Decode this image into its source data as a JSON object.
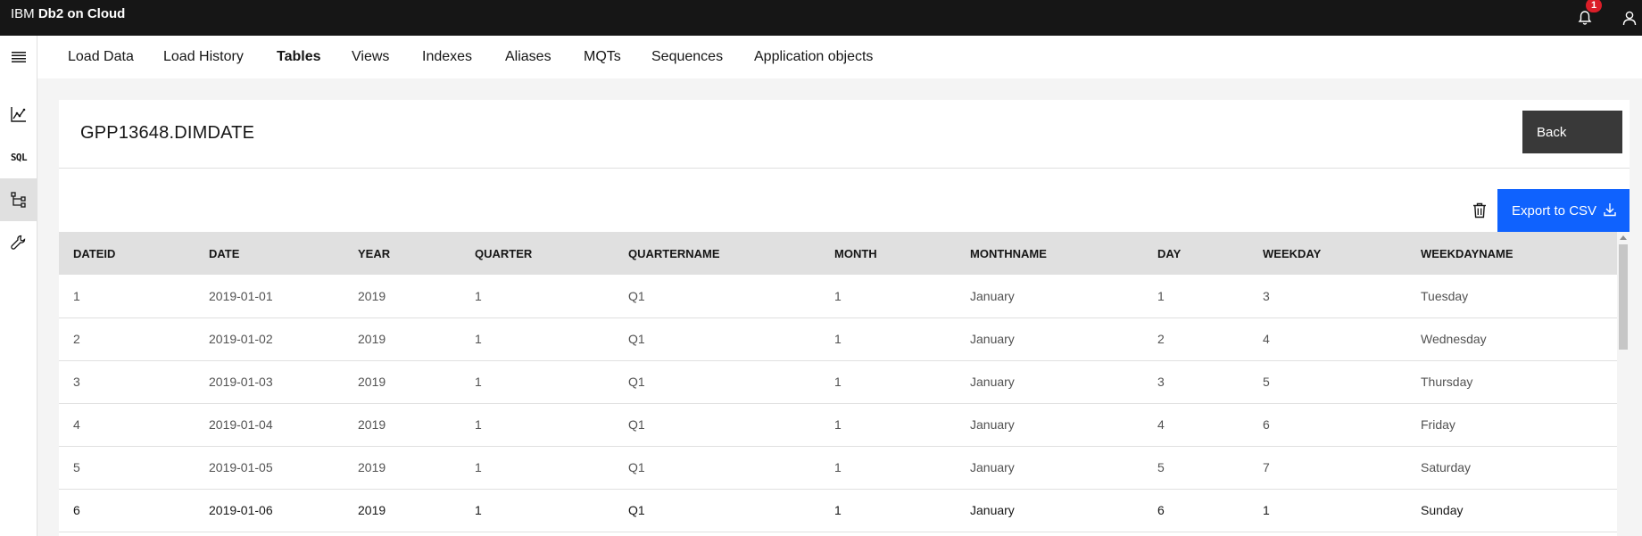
{
  "header": {
    "brand_prefix": "IBM",
    "brand_name": "Db2 on Cloud",
    "notification_count": "1"
  },
  "nav": {
    "tabs": [
      {
        "label": "Load Data",
        "active": false
      },
      {
        "label": "Load History",
        "active": false
      },
      {
        "label": "Tables",
        "active": true
      },
      {
        "label": "Views",
        "active": false
      },
      {
        "label": "Indexes",
        "active": false
      },
      {
        "label": "Aliases",
        "active": false
      },
      {
        "label": "MQTs",
        "active": false
      },
      {
        "label": "Sequences",
        "active": false
      },
      {
        "label": "Application objects",
        "active": false
      }
    ]
  },
  "rail": {
    "sql_label": "SQL"
  },
  "card": {
    "title": "GPP13648.DIMDATE",
    "back_label": "Back",
    "export_label": "Export to CSV"
  },
  "table": {
    "columns": [
      "DATEID",
      "DATE",
      "YEAR",
      "QUARTER",
      "QUARTERNAME",
      "MONTH",
      "MONTHNAME",
      "DAY",
      "WEEKDAY",
      "WEEKDAYNAME"
    ],
    "rows": [
      [
        "1",
        "2019-01-01",
        "2019",
        "1",
        "Q1",
        "1",
        "January",
        "1",
        "3",
        "Tuesday"
      ],
      [
        "2",
        "2019-01-02",
        "2019",
        "1",
        "Q1",
        "1",
        "January",
        "2",
        "4",
        "Wednesday"
      ],
      [
        "3",
        "2019-01-03",
        "2019",
        "1",
        "Q1",
        "1",
        "January",
        "3",
        "5",
        "Thursday"
      ],
      [
        "4",
        "2019-01-04",
        "2019",
        "1",
        "Q1",
        "1",
        "January",
        "4",
        "6",
        "Friday"
      ],
      [
        "5",
        "2019-01-05",
        "2019",
        "1",
        "Q1",
        "1",
        "January",
        "5",
        "7",
        "Saturday"
      ],
      [
        "6",
        "2019-01-06",
        "2019",
        "1",
        "Q1",
        "1",
        "January",
        "6",
        "1",
        "Sunday"
      ]
    ]
  },
  "colors": {
    "topbar": "#161616",
    "primary_button": "#0f62fe",
    "secondary_button": "#393939",
    "badge": "#da1e28"
  }
}
